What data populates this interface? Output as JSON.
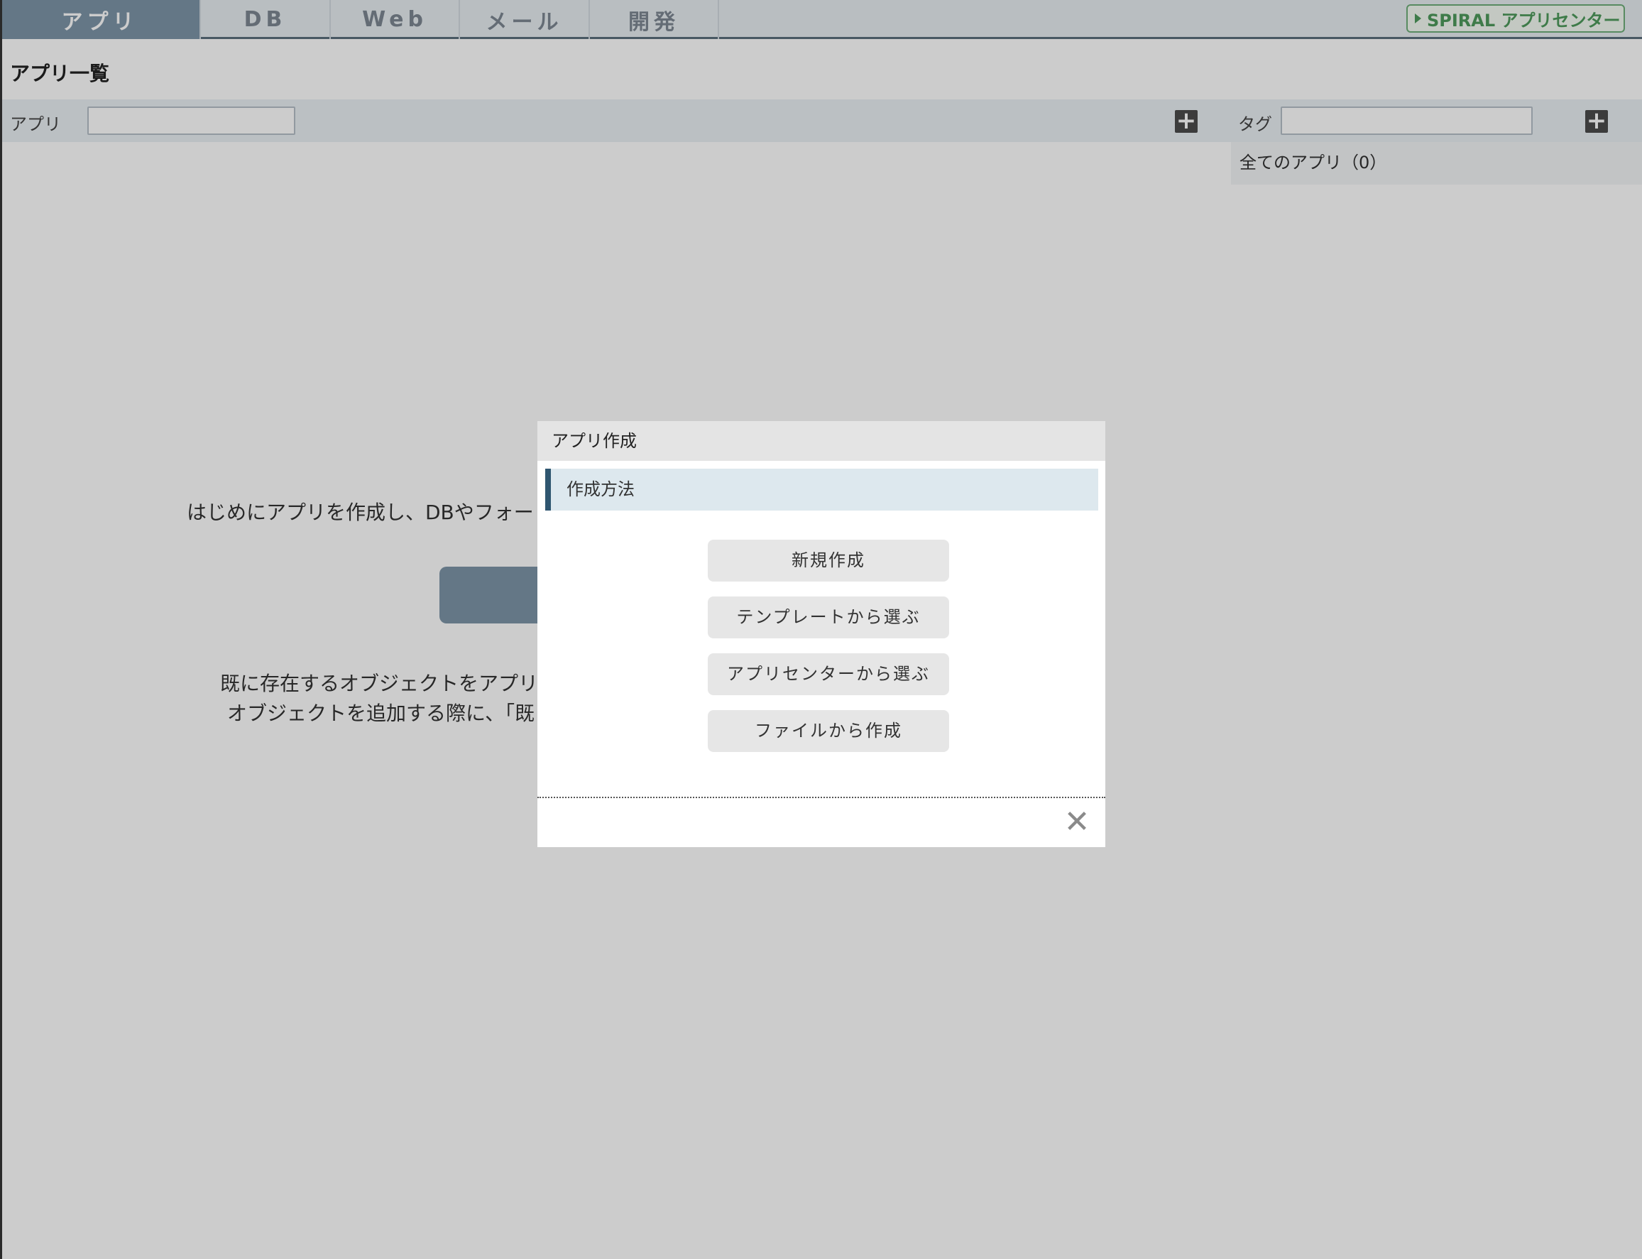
{
  "topnav": {
    "tabs": [
      {
        "label": "アプリ",
        "active": true
      },
      {
        "label": "DB",
        "active": false
      },
      {
        "label": "Web",
        "active": false
      },
      {
        "label": "メール",
        "active": false
      },
      {
        "label": "開発",
        "active": false
      }
    ],
    "appcenter_label": "SPIRAL アプリセンター"
  },
  "page": {
    "title": "アプリ一覧"
  },
  "filter": {
    "app_label": "アプリ",
    "app_value": "",
    "tag_label": "タグ",
    "tag_value": "",
    "all_apps": "全てのアプリ（0）"
  },
  "main": {
    "intro": "はじめにアプリを作成し、DBやフォー",
    "note_line1": "既に存在するオブジェクトをアプリ",
    "note_line2": "オブジェクトを追加する際に、「既"
  },
  "modal": {
    "title": "アプリ作成",
    "section_label": "作成方法",
    "buttons": [
      "新規作成",
      "テンプレートから選ぶ",
      "アプリセンターから選ぶ",
      "ファイルから作成"
    ]
  },
  "colors": {
    "nav_active": "#7d95a8",
    "section_accent": "#2f5670",
    "appcenter_green": "#4e9a5c"
  }
}
